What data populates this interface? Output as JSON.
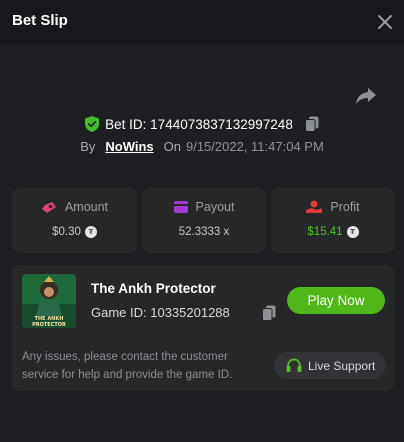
{
  "header": {
    "title": "Bet Slip",
    "close_icon": "close-icon"
  },
  "bet": {
    "id_label": "Bet ID: 1744073837132997248",
    "by_label": "By",
    "username": "NoWins",
    "on_label": "On",
    "datetime": "9/15/2022, 11:47:04 PM"
  },
  "stats": {
    "amount": {
      "label": "Amount",
      "value": "$0.30"
    },
    "payout": {
      "label": "Payout",
      "value": "52.3333 x"
    },
    "profit": {
      "label": "Profit",
      "value": "$15.41"
    }
  },
  "game": {
    "name": "The Ankh Protector",
    "id_label": "Game ID: 10335201288",
    "play_label": "Play Now",
    "thumb_text": "THE ANKH PROTECTOR"
  },
  "support": {
    "info": "Any issues, please contact the customer service for help and provide the game ID.",
    "button_label": "Live Support"
  },
  "colors": {
    "accent_green": "#4fb718",
    "profit_green": "#4ec520",
    "icon_pink": "#e0437a",
    "icon_purple": "#a13ad4",
    "icon_red": "#e23a3a"
  }
}
